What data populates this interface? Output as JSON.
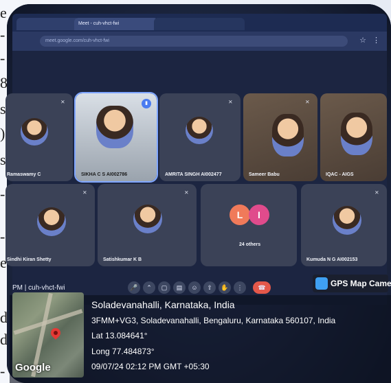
{
  "browser": {
    "tabs": [
      "",
      "Meet - cuh-vhct-fwi",
      ""
    ],
    "url": "meet.google.com/cuh-vhct-fwi"
  },
  "participants": [
    {
      "name": "Ramaswamy C",
      "state": "muted"
    },
    {
      "name": "SIKHA C S AI002786",
      "state": "speaking"
    },
    {
      "name": "AMRITA SINGH AI002477",
      "state": "muted"
    },
    {
      "name": "Sameer Babu",
      "state": "muted"
    },
    {
      "name": "IQAC - AIGS",
      "state": "video"
    },
    {
      "name": "Sindhi Kiran Shetty",
      "state": "muted"
    },
    {
      "name": "Satishkumar K B",
      "state": "muted"
    },
    {
      "name": "24 others",
      "state": "group",
      "initials": [
        "L",
        "I"
      ]
    },
    {
      "name": "Kumuda N G AI002153",
      "state": "muted"
    }
  ],
  "controls": {
    "meeting_id": "PM | cuh-vhct-fwi",
    "end_call": "end-call-icon"
  },
  "gps_camera": {
    "app_name": "GPS Map Camera",
    "place": "Soladevanahalli, Karnataka, India",
    "address": "3FMM+VG3, Soladevanahalli, Bengaluru, Karnataka 560107, India",
    "lat": "Lat 13.084641°",
    "long": "Long 77.484873°",
    "timestamp": "09/07/24 02:12 PM GMT +05:30",
    "map_brand": "Google"
  },
  "background_margin": [
    "e",
    "-",
    "-",
    "8",
    "s",
    ")",
    "s.",
    "-",
    "-",
    "e",
    "d.",
    "d",
    "-"
  ],
  "colors": {
    "accent": "#4a7bf0",
    "end_call": "#e4584a",
    "others_L": "#f07a5a",
    "others_I": "#e04b8c"
  }
}
